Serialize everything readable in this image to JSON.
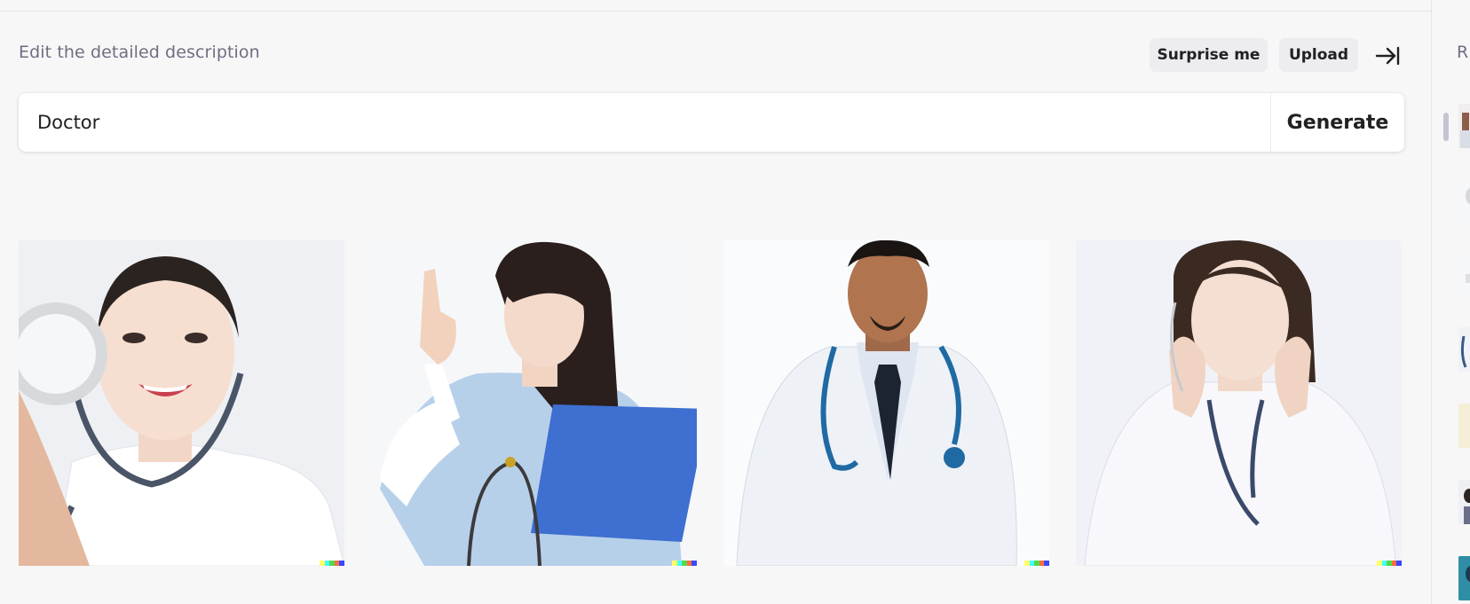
{
  "header": {
    "label": "Edit the detailed description",
    "surprise_label": "Surprise me",
    "upload_label": "Upload"
  },
  "prompt": {
    "value": "Doctor",
    "generate_label": "Generate"
  },
  "results": [
    {
      "alt": "Smiling woman doctor holding a stethoscope toward the camera"
    },
    {
      "alt": "Woman in light blue scrubs pointing up, holding a blue clipboard"
    },
    {
      "alt": "Man in white coat with tie and blue stethoscope"
    },
    {
      "alt": "Woman doctor in white coat touching her neck, stethoscope around neck"
    }
  ],
  "sidebar": {
    "title": "R"
  },
  "colors": {
    "background": "#f7f7f8",
    "button_bg": "#ececf1",
    "text": "#202123",
    "muted": "#6e6e80",
    "signature": [
      "#ffff66",
      "#42ffff",
      "#51da4c",
      "#ff6e3c",
      "#3c46ff"
    ]
  },
  "icons": {
    "collapse": "arrow-right-to-bar-icon"
  }
}
